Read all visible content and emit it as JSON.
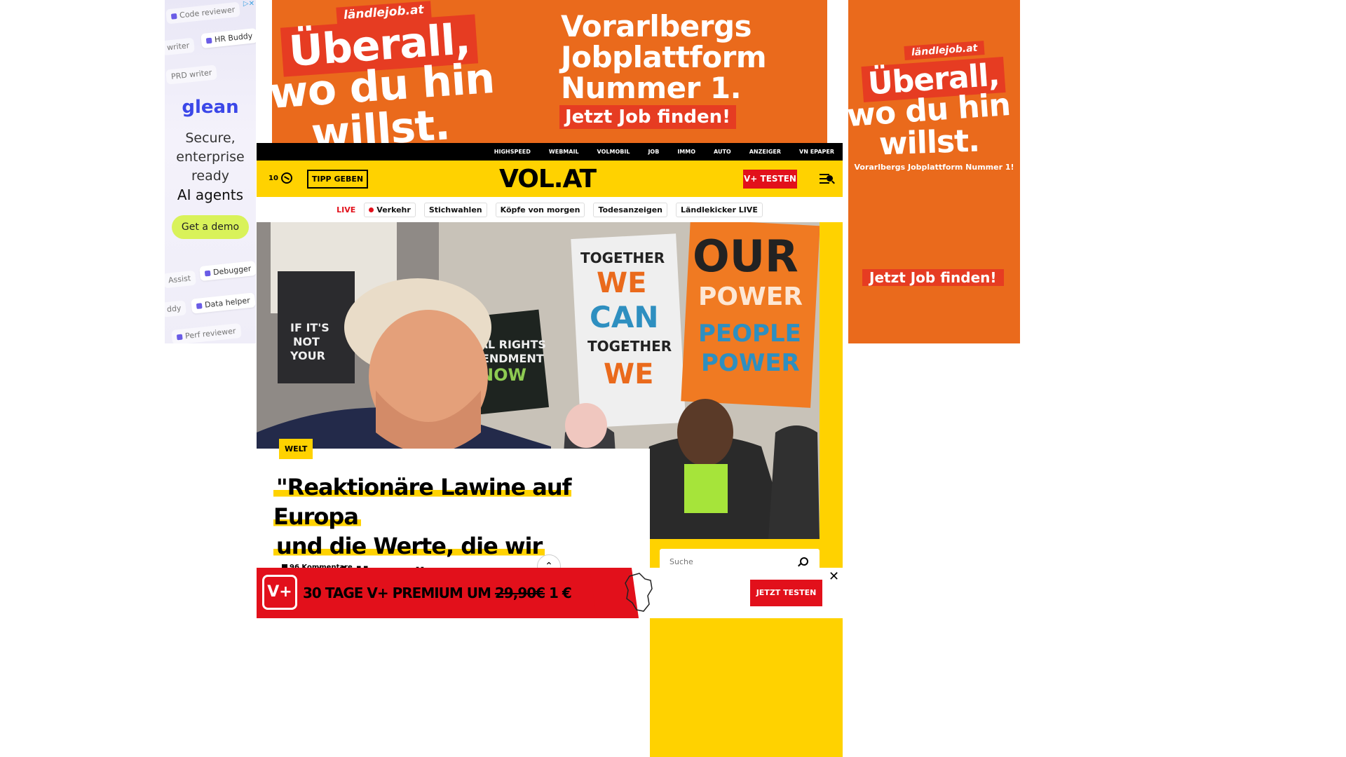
{
  "ad_left": {
    "adchoices": "▷✕",
    "chips": [
      "Code reviewer",
      "writer",
      "HR Buddy",
      "PRD writer",
      "Assist",
      "Debugger",
      "ddy",
      "Data helper",
      "Perf reviewer"
    ],
    "brand": "glean",
    "copy": "Secure, enterprise ready",
    "copy_bold": "AI agents",
    "cta": "Get a demo"
  },
  "ad_top": {
    "brand": "ländlejob.at",
    "slogan_1": "Überall,",
    "slogan_2": "wo du hin",
    "slogan_3": "willst.",
    "right_copy_1": "Vorarlbergs",
    "right_copy_2": "Jobplattform",
    "right_copy_3": "Nummer 1.",
    "cta": "Jetzt Job finden!"
  },
  "ad_right": {
    "brand": "ländlejob.at",
    "slogan_1": "Überall,",
    "slogan_2": "wo du hin",
    "slogan_3": "willst.",
    "subline": "Vorarlbergs Jobplattform Nummer 1!",
    "cta": "Jetzt Job finden!"
  },
  "topnav": [
    "HIGHSPEED",
    "WEBMAIL",
    "VOLMOBIL",
    "JOB",
    "IMMO",
    "AUTO",
    "ANZEIGER",
    "VN EPAPER"
  ],
  "header": {
    "temperature": "10",
    "tipp": "TIPP GEBEN",
    "logo": "VOL.AT",
    "vplus": "V+ TESTEN"
  },
  "livebar": {
    "live": "LIVE",
    "items": [
      "Verkehr",
      "Stichwahlen",
      "Köpfe von morgen",
      "Todesanzeigen",
      "Ländlekicker LIVE"
    ]
  },
  "hero": {
    "sign_1": "TOGETHER",
    "sign_2": "WE",
    "sign_3": "CAN",
    "sign_4": "TOGETHER",
    "sign_5": "WE",
    "sign_6": "OUR",
    "sign_7": "POWER",
    "sign_8": "PEOPLE",
    "sign_9": "POWER",
    "sign_10": "UAL RIGHTS",
    "sign_11": "MENDMENT",
    "sign_12": "NOW",
    "sign_13": "IF IT'S",
    "sign_14": "NOT",
    "sign_15": "YOUR"
  },
  "article": {
    "kicker": "WELT",
    "headline_1": "\"Reaktionäre Lawine auf Europa",
    "headline_2": "und die Werte, die wir",
    "headline_3": "verteidigen\"",
    "comments": "96 Kommentare",
    "scroll_up": "⌃"
  },
  "search": {
    "placeholder": "Suche"
  },
  "premium": {
    "vbox": "V+",
    "offer_1": "30 TAGE V+ PREMIUM UM ",
    "offer_old": "29,90€",
    "offer_new": " 1 €",
    "try": "JETZT TESTEN",
    "close": "✕"
  }
}
